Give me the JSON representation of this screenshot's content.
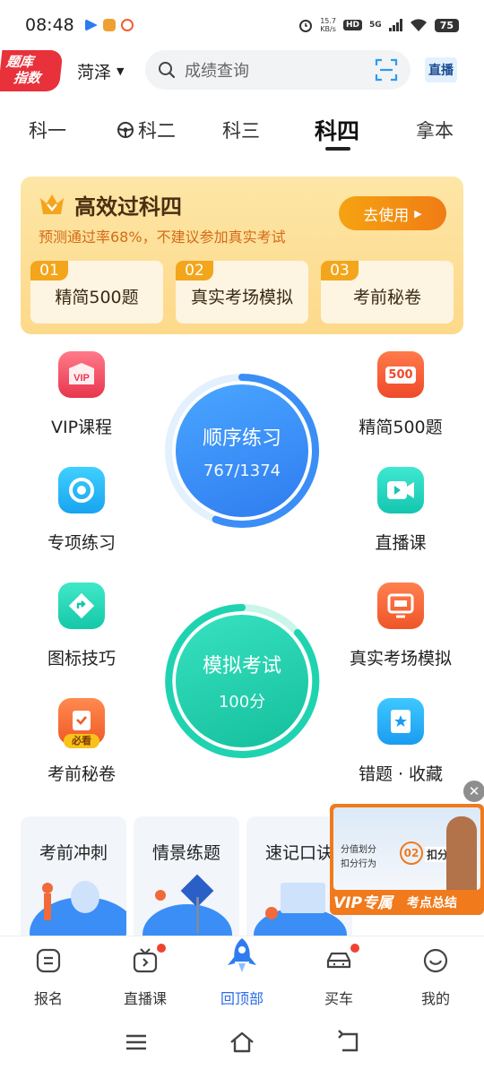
{
  "status": {
    "time": "08:48",
    "net_speed_top": "15.7",
    "net_speed_bottom": "KB/s",
    "hd": "HD",
    "network": "5G",
    "battery": "75"
  },
  "header": {
    "logo_line1": "题库",
    "logo_line2": "指数",
    "city": "菏泽",
    "search_placeholder": "成绩查询",
    "live_button": "直播"
  },
  "tabs": [
    {
      "label": "科一",
      "active": false
    },
    {
      "label": "科二",
      "active": false
    },
    {
      "label": "科三",
      "active": false
    },
    {
      "label": "科四",
      "active": true
    },
    {
      "label": "拿本",
      "active": false
    }
  ],
  "promo": {
    "title": "高效过科四",
    "subtitle": "预测通过率68%，不建议参加真实考试",
    "button": "去使用",
    "items": [
      {
        "num": "01",
        "label": "精简500题"
      },
      {
        "num": "02",
        "label": "真实考场模拟"
      },
      {
        "num": "03",
        "label": "考前秘卷"
      }
    ]
  },
  "features_left": [
    {
      "label": "VIP课程",
      "icon": "vip-course-icon"
    },
    {
      "label": "专项练习",
      "icon": "special-practice-icon"
    },
    {
      "label": "图标技巧",
      "icon": "sign-tips-icon"
    },
    {
      "label": "考前秘卷",
      "icon": "secret-paper-icon",
      "badge": "必看"
    }
  ],
  "features_right": [
    {
      "label": "精简500题",
      "icon": "500-questions-icon",
      "badge": "500"
    },
    {
      "label": "直播课",
      "icon": "live-class-icon"
    },
    {
      "label": "真实考场模拟",
      "icon": "exam-simulation-icon"
    },
    {
      "label": "错题 · 收藏",
      "icon": "mistakes-favorites-icon"
    }
  ],
  "sequential": {
    "title": "顺序练习",
    "progress": "767/1374",
    "progress_fraction": 0.558
  },
  "mock_exam": {
    "title": "模拟考试",
    "score": "100分"
  },
  "cards": [
    {
      "title": "考前冲刺"
    },
    {
      "title": "情景练题"
    },
    {
      "title": "速记口诀"
    }
  ],
  "video": {
    "tag_left": "VIP专属",
    "tag_right": "考点总结",
    "line1": "分值划分",
    "line2": "扣分行为",
    "num": "02",
    "heading": "扣分分值"
  },
  "bottom_nav": [
    {
      "label": "报名",
      "icon": "signup-icon",
      "active": false,
      "dot": false
    },
    {
      "label": "直播课",
      "icon": "live-tv-icon",
      "active": false,
      "dot": true
    },
    {
      "label": "回顶部",
      "icon": "rocket-icon",
      "active": true,
      "dot": false
    },
    {
      "label": "买车",
      "icon": "car-icon",
      "active": false,
      "dot": true
    },
    {
      "label": "我的",
      "icon": "profile-icon",
      "active": false,
      "dot": false
    }
  ],
  "colors": {
    "accent_blue": "#2a6de8",
    "promo_orange": "#f3a61b",
    "sequential_blue": "#3a8ef6",
    "mock_green": "#1fd3b0",
    "badge_red": "#f0432f"
  }
}
